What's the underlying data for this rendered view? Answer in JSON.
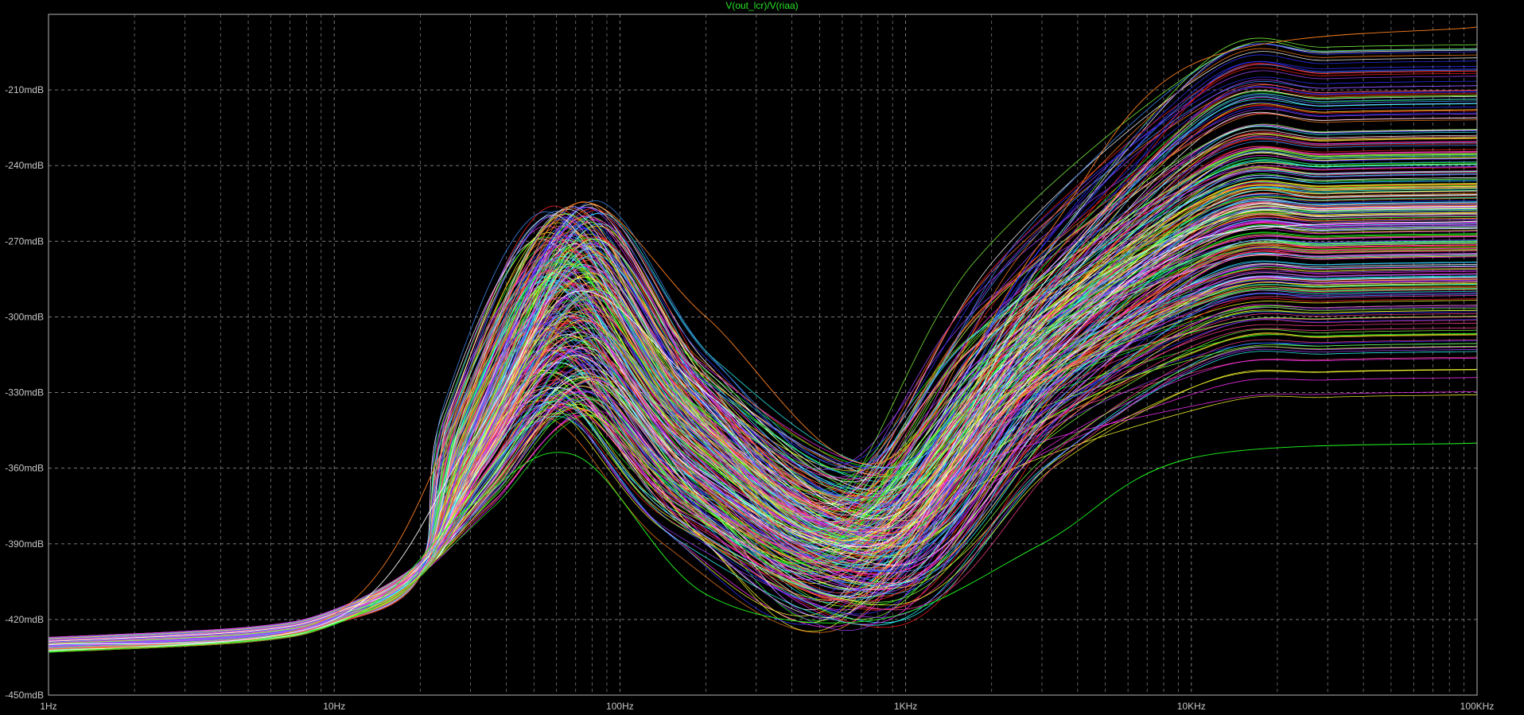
{
  "title": "V(out_lcr)/V(riaa)",
  "colors": {
    "background": "#000000",
    "grid": "#8a8a8a",
    "frame": "#b4b4b4",
    "title": "#26e626",
    "tick_label": "#c8c8c8",
    "trace_palette": [
      "#ff2020",
      "#20ff20",
      "#3030ff",
      "#ff30ff",
      "#ffff30",
      "#30ffff",
      "#ffffff",
      "#ff8020",
      "#a040ff",
      "#80ff40",
      "#ff4090",
      "#4090ff"
    ]
  },
  "chart_data": {
    "type": "line",
    "title": "V(out_lcr)/V(riaa)",
    "xlabel": "",
    "ylabel": "",
    "x_scale": "log",
    "xlim_hz": [
      1,
      100000
    ],
    "ylim_db": [
      -450,
      -180
    ],
    "grid": true,
    "x_ticks": [
      {
        "value": 1,
        "label": "1Hz"
      },
      {
        "value": 10,
        "label": "10Hz"
      },
      {
        "value": 100,
        "label": "100Hz"
      },
      {
        "value": 1000,
        "label": "1KHz"
      },
      {
        "value": 10000,
        "label": "10KHz"
      },
      {
        "value": 100000,
        "label": "100KHz"
      }
    ],
    "y_ticks": [
      {
        "value": -210,
        "label": "-210mdB"
      },
      {
        "value": -240,
        "label": "-240mdB"
      },
      {
        "value": -270,
        "label": "-270mdB"
      },
      {
        "value": -300,
        "label": "-300mdB"
      },
      {
        "value": -330,
        "label": "-330mdB"
      },
      {
        "value": -360,
        "label": "-360mdB"
      },
      {
        "value": -390,
        "label": "-390mdB"
      },
      {
        "value": -420,
        "label": "-420mdB"
      },
      {
        "value": -450,
        "label": "-450mdB"
      }
    ],
    "monte_carlo_family": {
      "count": 300,
      "shape": "low plateau, resonance peak near 70Hz, dip near 800Hz, high plateau above 20KHz",
      "low_freq_level_db": [
        -433,
        -427
      ],
      "peak": {
        "freq_hz": 70,
        "level_db_range": [
          -355,
          -254
        ]
      },
      "dip": {
        "freq_hz": 800,
        "level_db_range": [
          -427,
          -355
        ]
      },
      "high_freq_level_db_range": [
        -352,
        -185
      ]
    },
    "series": [
      {
        "x": [
          1,
          10,
          30,
          70,
          200,
          800,
          3000,
          10000,
          100000
        ],
        "y": [
          -432,
          -418,
          -330,
          -255,
          -300,
          -358,
          -270,
          -200,
          -185
        ]
      },
      {
        "x": [
          1,
          10,
          30,
          70,
          200,
          800,
          3000,
          10000,
          100000
        ],
        "y": [
          -430,
          -420,
          -350,
          -290,
          -330,
          -380,
          -320,
          -270,
          -262
        ]
      },
      {
        "x": [
          1,
          10,
          30,
          70,
          200,
          800,
          3000,
          10000,
          100000
        ],
        "y": [
          -433,
          -422,
          -375,
          -355,
          -410,
          -420,
          -390,
          -356,
          -350
        ]
      }
    ]
  }
}
